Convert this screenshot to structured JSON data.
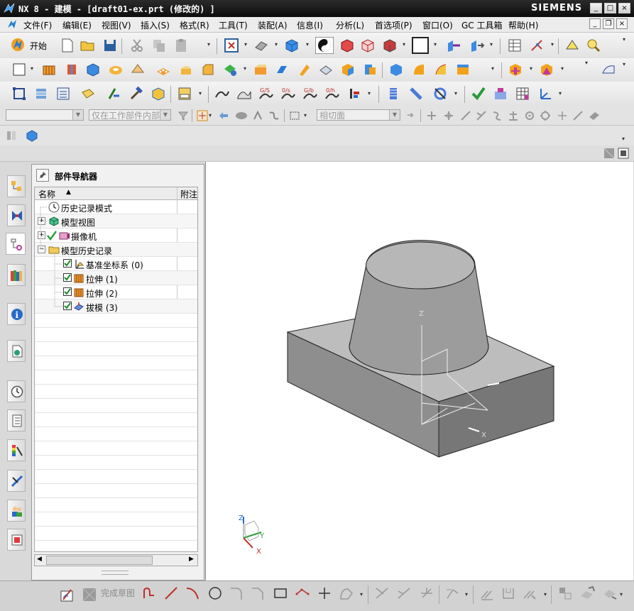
{
  "window": {
    "title": "NX 8 - 建模 - [draft01-ex.prt (修改的) ]",
    "brand": "SIEMENS",
    "controls": {
      "minimize": "_",
      "maximize": "□",
      "close": "×"
    }
  },
  "menu": {
    "items": [
      "文件(F)",
      "编辑(E)",
      "视图(V)",
      "插入(S)",
      "格式(R)",
      "工具(T)",
      "装配(A)",
      "信息(I)",
      "分析(L)",
      "首选项(P)",
      "窗口(O)",
      "GC 工具箱",
      "帮助(H)"
    ]
  },
  "toolbar": {
    "start_label": "开始"
  },
  "selection_bar": {
    "filter_value": "",
    "scope_value": "仅在工作部件内部",
    "intent_value": "相切面"
  },
  "navigator": {
    "title": "部件导航器",
    "columns": {
      "name": "名称",
      "attach": "附注"
    },
    "items": [
      {
        "label": "历史记录模式",
        "icon": "clock-icon"
      },
      {
        "label": "模型视图",
        "icon": "model-views-icon"
      },
      {
        "label": "摄像机",
        "icon": "camera-icon"
      },
      {
        "label": "模型历史记录",
        "icon": "folder-icon"
      },
      {
        "label": "基准坐标系 (0)",
        "icon": "datum-csys-icon"
      },
      {
        "label": "拉伸 (1)",
        "icon": "extrude-icon"
      },
      {
        "label": "拉伸 (2)",
        "icon": "extrude-icon"
      },
      {
        "label": "拔模 (3)",
        "icon": "draft-icon"
      }
    ]
  },
  "viewport": {
    "triad_labels": {
      "x": "X",
      "y": "Y",
      "z": "Z"
    },
    "wcs_labels": {
      "x": "X",
      "z": "Z"
    }
  },
  "statusbar": {
    "finish_sketch_label": "完成草图"
  }
}
